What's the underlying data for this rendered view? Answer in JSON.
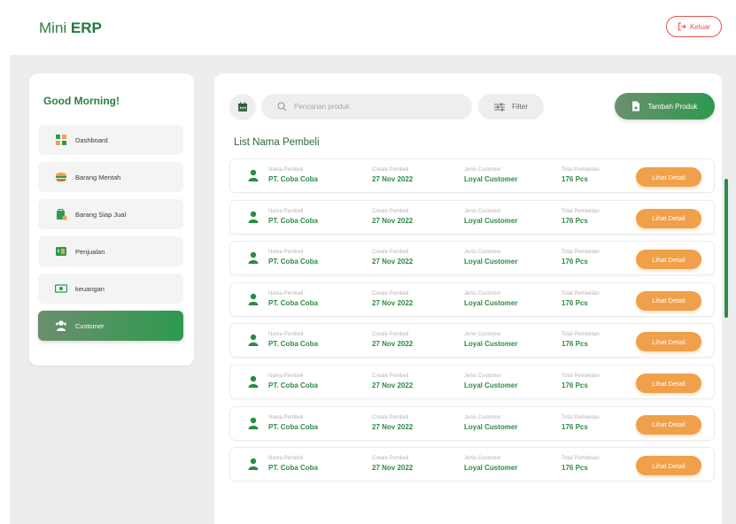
{
  "app": {
    "logo_light": "Mini ",
    "logo_bold": "ERP"
  },
  "header": {
    "logout_label": "Keluar"
  },
  "sidebar": {
    "greeting": "Good Morning!",
    "items": [
      {
        "label": "Dashboard",
        "icon": "dashboard-icon"
      },
      {
        "label": "Barang Mentah",
        "icon": "raw-goods-icon"
      },
      {
        "label": "Barang Siap Jual",
        "icon": "ready-goods-icon"
      },
      {
        "label": "Penjualan",
        "icon": "sales-icon"
      },
      {
        "label": "keuangan",
        "icon": "finance-icon"
      },
      {
        "label": "Customer",
        "icon": "customer-icon",
        "active": true
      }
    ]
  },
  "toolbar": {
    "search_placeholder": "Pencarian produk",
    "filter_label": "Filter",
    "add_label": "Tambah Produk"
  },
  "list": {
    "title": "List Nama Pembeli",
    "columns": [
      "Nama Pembeli",
      "Create Pembeli",
      "Jenis Customer",
      "Total Pembelian"
    ],
    "action_label": "Lihat Detail",
    "rows": [
      {
        "name": "PT. Coba Coba",
        "created": "27 Nov 2022",
        "type": "Loyal Customer",
        "total": "176 Pcs"
      },
      {
        "name": "PT. Coba Coba",
        "created": "27 Nov 2022",
        "type": "Loyal Customer",
        "total": "176 Pcs"
      },
      {
        "name": "PT. Coba Coba",
        "created": "27 Nov 2022",
        "type": "Loyal Customer",
        "total": "176 Pcs"
      },
      {
        "name": "PT. Coba Coba",
        "created": "27 Nov 2022",
        "type": "Loyal Customer",
        "total": "176 Pcs"
      },
      {
        "name": "PT. Coba Coba",
        "created": "27 Nov 2022",
        "type": "Loyal Customer",
        "total": "176 Pcs"
      },
      {
        "name": "PT. Coba Coba",
        "created": "27 Nov 2022",
        "type": "Loyal Customer",
        "total": "176 Pcs"
      },
      {
        "name": "PT. Coba Coba",
        "created": "27 Nov 2022",
        "type": "Loyal Customer",
        "total": "176 Pcs"
      },
      {
        "name": "PT. Coba Coba",
        "created": "27 Nov 2022",
        "type": "Loyal Customer",
        "total": "176 Pcs"
      }
    ]
  },
  "colors": {
    "brand_green": "#2d9a4e",
    "action_orange": "#f0a04b",
    "logout_red": "#e05555"
  }
}
